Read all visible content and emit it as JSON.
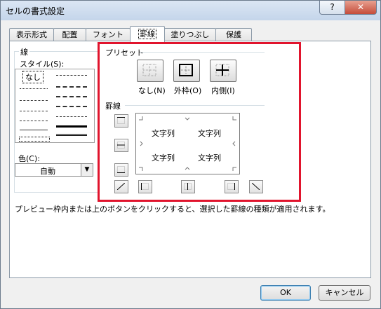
{
  "window": {
    "title": "セルの書式設定",
    "help_label": "?",
    "close_label": "✕"
  },
  "tabs": [
    {
      "label": "表示形式"
    },
    {
      "label": "配置"
    },
    {
      "label": "フォント"
    },
    {
      "label": "罫線",
      "active": true
    },
    {
      "label": "塗りつぶし"
    },
    {
      "label": "保護"
    }
  ],
  "line_group": {
    "title": "線",
    "style_label": "スタイル(S):",
    "none_label": "なし",
    "color_label": "色(C):",
    "color_value": "自動"
  },
  "presets": {
    "title": "プリセット",
    "items": [
      {
        "label": "なし(N)",
        "icon": "preset-none-icon"
      },
      {
        "label": "外枠(O)",
        "icon": "preset-outline-icon"
      },
      {
        "label": "内側(I)",
        "icon": "preset-inside-icon"
      }
    ]
  },
  "border": {
    "title": "罫線",
    "cells": [
      "文字列",
      "文字列",
      "文字列",
      "文字列"
    ]
  },
  "hint": "プレビュー枠内または上のボタンをクリックすると、選択した罫線の種類が適用されます。",
  "footer": {
    "ok_label": "OK",
    "cancel_label": "キャンセル"
  },
  "colors": {
    "highlight": "#e1142d",
    "title_bar": "#c4d5ea",
    "close": "#c54c3a"
  }
}
